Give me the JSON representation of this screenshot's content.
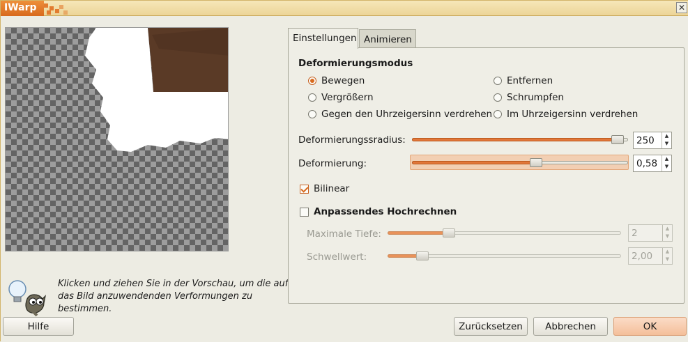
{
  "window": {
    "title": "IWarp",
    "close_icon": "close-icon"
  },
  "hint": {
    "lines": [
      "Klicken und ziehen Sie in der Vorschau, um die auf",
      "das Bild anzuwendenden Verformungen zu",
      "bestimmen."
    ],
    "icon": "wilber-lightbulb-icon"
  },
  "tabs": [
    {
      "label": "Einstellungen",
      "active": true
    },
    {
      "label": "Animieren",
      "active": false
    }
  ],
  "settings": {
    "mode_title": "Deformierungsmodus",
    "modes": [
      {
        "label": "Bewegen",
        "selected": true
      },
      {
        "label": "Entfernen",
        "selected": false
      },
      {
        "label": "Vergrößern",
        "selected": false
      },
      {
        "label": "Schrumpfen",
        "selected": false
      },
      {
        "label": "Gegen den Uhrzeigersinn verdrehen",
        "selected": false
      },
      {
        "label": "Im Uhrzeigersinn verdrehen",
        "selected": false
      }
    ],
    "radius": {
      "label": "Deformierungssradius:",
      "value": "250",
      "fraction": 0.98
    },
    "amount": {
      "label": "Deformierung:",
      "value": "0,58",
      "fraction": 0.58
    },
    "bilinear": {
      "label": "Bilinear",
      "checked": true
    },
    "adaptive": {
      "label": "Anpassendes Hochrechnen",
      "checked": false
    },
    "max_depth": {
      "label": "Maximale Tiefe:",
      "value": "2",
      "fraction": 0.25
    },
    "threshold": {
      "label": "Schwellwert:",
      "value": "2,00",
      "fraction": 0.13
    }
  },
  "buttons": {
    "help": "Hilfe",
    "reset": "Zurücksetzen",
    "cancel": "Abbrechen",
    "ok": "OK"
  },
  "colors": {
    "accent": "#d86a1e",
    "titlebar": "#ecd497"
  }
}
